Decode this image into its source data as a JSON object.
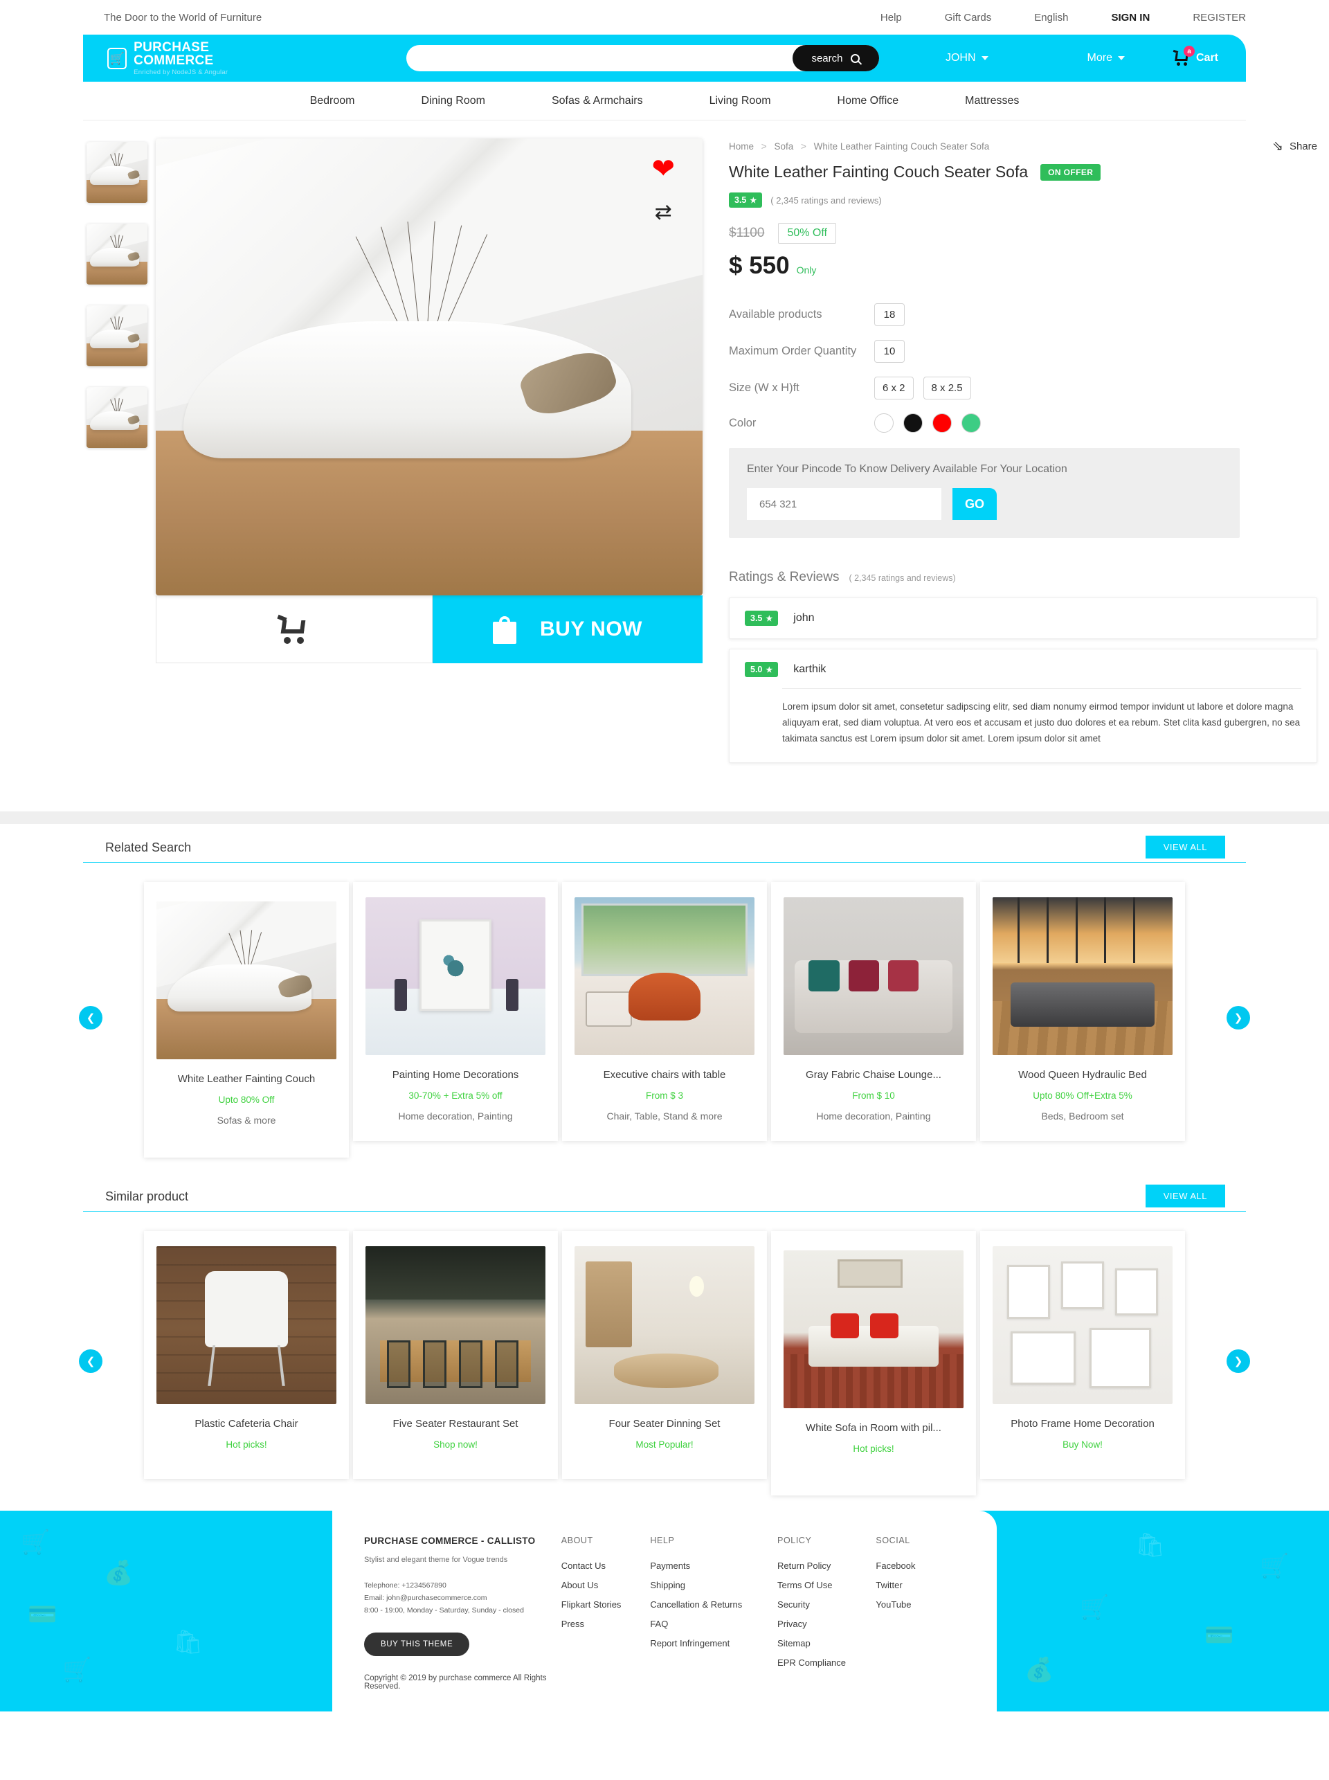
{
  "topbar": {
    "tagline": "The Door to the World of Furniture",
    "links": [
      {
        "label": "Help",
        "bold": false
      },
      {
        "label": "Gift Cards",
        "bold": false
      },
      {
        "label": "English",
        "bold": false
      },
      {
        "label": "SIGN IN",
        "bold": true
      },
      {
        "label": "REGISTER",
        "bold": false
      }
    ]
  },
  "header": {
    "brand_name": "PURCHASE COMMERCE",
    "brand_sub": "Enriched by NodeJS & Angular",
    "search_placeholder": "",
    "search_value": "",
    "search_button": "search",
    "user_menu": "JOHN",
    "more_menu": "More",
    "cart_label": "Cart",
    "cart_count": "a"
  },
  "nav": {
    "items": [
      "Bedroom",
      "Dining Room",
      "Sofas & Armchairs",
      "Living Room",
      "Home Office",
      "Mattresses"
    ]
  },
  "product": {
    "breadcrumb": [
      "Home",
      "Sofa",
      "White Leather Fainting Couch Seater Sofa"
    ],
    "share_label": "Share",
    "title": "White Leather Fainting Couch Seater Sofa",
    "offer_badge": "ON OFFER",
    "rating": "3.5",
    "rating_count": "( 2,345 ratings and reviews)",
    "old_price": "$1100",
    "discount": "50% Off",
    "price": "$ 550",
    "price_suffix": "Only",
    "options": [
      {
        "label": "Available products",
        "values": [
          "18"
        ]
      },
      {
        "label": "Maximum Order Quantity",
        "values": [
          "10"
        ]
      },
      {
        "label": "Size (W x H)ft",
        "values": [
          "6 x 2",
          "8 x 2.5"
        ]
      }
    ],
    "color_label": "Color",
    "colors": [
      "#ffffff",
      "#111111",
      "#ff0000",
      "#3dcd84"
    ],
    "add_to_cart": "",
    "buy_now": "BUY NOW",
    "thumb_count": 4
  },
  "pincode": {
    "title": "Enter Your Pincode To Know Delivery Available For Your Location",
    "placeholder": "654 321",
    "button": "GO"
  },
  "reviews": {
    "heading": "Ratings & Reviews",
    "sub": "( 2,345 ratings and reviews)",
    "items": [
      {
        "rating": "3.5",
        "name": "john",
        "body": ""
      },
      {
        "rating": "5.0",
        "name": "karthik",
        "body": "Lorem ipsum dolor sit amet, consetetur sadipscing elitr, sed diam nonumy eirmod tempor invidunt ut labore et dolore magna aliquyam erat, sed diam voluptua. At vero eos et accusam et justo duo dolores et ea rebum. Stet clita kasd gubergren, no sea takimata sanctus est Lorem ipsum dolor sit amet. Lorem ipsum dolor sit amet"
      }
    ]
  },
  "related": {
    "title": "Related Search",
    "view_all": "VIEW ALL",
    "cards": [
      {
        "title": "White Leather Fainting Couch",
        "offer": "Upto 80% Off",
        "cat": "Sofas & more",
        "scene": "sofa"
      },
      {
        "title": "Painting Home Decorations",
        "offer": "30-70% + Extra 5% off",
        "cat": "Home decoration, Painting",
        "scene": "painting"
      },
      {
        "title": "Executive chairs with table",
        "offer": "From $ 3",
        "cat": "Chair, Table, Stand & more",
        "scene": "chair"
      },
      {
        "title": "Gray Fabric Chaise Lounge...",
        "offer": "From $ 10",
        "cat": "Home decoration, Painting",
        "scene": "gray"
      },
      {
        "title": "Wood Queen Hydraulic Bed",
        "offer": "Upto 80% Off+Extra 5%",
        "cat": "Beds, Bedroom set",
        "scene": "bed"
      }
    ]
  },
  "similar": {
    "title": "Similar product",
    "view_all": "VIEW ALL",
    "cards": [
      {
        "title": "Plastic Cafeteria Chair",
        "offer": "Hot picks!",
        "cat": "",
        "scene": "plastic"
      },
      {
        "title": "Five Seater Restaurant Set",
        "offer": "Shop now!",
        "cat": "",
        "scene": "rest"
      },
      {
        "title": "Four Seater Dinning Set",
        "offer": "Most Popular!",
        "cat": "",
        "scene": "dining"
      },
      {
        "title": "White Sofa in Room with pil...",
        "offer": "Hot picks!",
        "cat": "",
        "scene": "whitesofa"
      },
      {
        "title": "Photo Frame Home Decoration",
        "offer": "Buy Now!",
        "cat": "",
        "scene": "photo"
      }
    ]
  },
  "footer": {
    "brand_title": "PURCHASE COMMERCE - CALLISTO",
    "tagline": "Stylist and elegant theme for Vogue trends",
    "telephone": "Telephone: +1234567890",
    "email": "Email: john@purchasecommerce.com",
    "hours": "8:00 - 19:00, Monday - Saturday, Sunday - closed",
    "buy_theme": "BUY THIS THEME",
    "copyright": "Copyright © 2019 by purchase commerce All Rights Reserved.",
    "columns": [
      {
        "heading": "ABOUT",
        "links": [
          "Contact Us",
          "About Us",
          "Flipkart Stories",
          "Press"
        ]
      },
      {
        "heading": "HELP",
        "links": [
          "Payments",
          "Shipping",
          "Cancellation & Returns",
          "FAQ",
          "Report Infringement"
        ]
      },
      {
        "heading": "POLICY",
        "links": [
          "Return Policy",
          "Terms Of Use",
          "Security",
          "Privacy",
          "Sitemap",
          "EPR Compliance"
        ]
      },
      {
        "heading": "SOCIAL",
        "links": [
          "Facebook",
          "Twitter",
          "YouTube"
        ]
      }
    ]
  },
  "colors": {
    "accent": "#00d2f8",
    "green": "#2fbd5a",
    "badge_pink": "#ff2d6f"
  }
}
